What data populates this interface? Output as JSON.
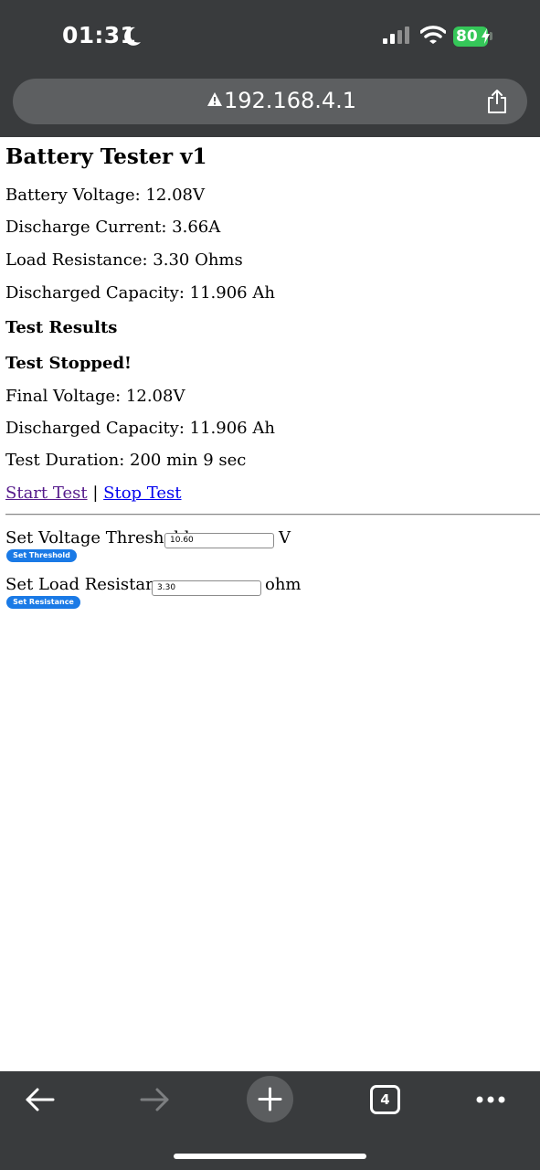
{
  "status_bar": {
    "time": "01:31",
    "battery_level": "80"
  },
  "browser": {
    "url": "192.168.4.1",
    "tab_count": "4"
  },
  "page": {
    "title": "Battery Tester v1",
    "readings": {
      "battery_voltage": "Battery Voltage: 12.08V",
      "discharge_current": "Discharge Current: 3.66A",
      "load_resistance": "Load Resistance: 3.30 Ohms",
      "discharged_capacity": "Discharged Capacity: 11.906 Ah"
    },
    "results": {
      "heading": "Test Results",
      "status": "Test Stopped!",
      "final_voltage": "Final Voltage: 12.08V",
      "discharged_capacity": "Discharged Capacity: 11.906 Ah",
      "duration": "Test Duration: 200 min 9 sec"
    },
    "links": {
      "start": "Start Test",
      "separator": "|",
      "stop": "Stop Test"
    },
    "forms": {
      "threshold": {
        "label": "Set Voltage Threshold:",
        "value": "10.60",
        "unit": "V",
        "button": "Set Threshold"
      },
      "resistance": {
        "label": "Set Load Resistance:",
        "value": "3.30",
        "unit": "ohm",
        "button": "Set Resistance"
      }
    }
  },
  "colors": {
    "chrome_background": "#393b3d",
    "url_pill": "#5d5f61",
    "battery_green": "#35c759",
    "button_blue": "#1a7ae6",
    "visited_link": "#551a8b",
    "link": "#0000ee"
  },
  "icons": {
    "moon": "moon-icon",
    "signal": "cellular-signal-icon",
    "wifi": "wifi-icon",
    "warning": "warning-triangle-icon",
    "share": "share-icon",
    "back": "back-arrow-icon",
    "forward": "forward-arrow-icon",
    "new_tab": "plus-icon",
    "tabs": "tabs-icon",
    "more": "more-dots-icon"
  }
}
